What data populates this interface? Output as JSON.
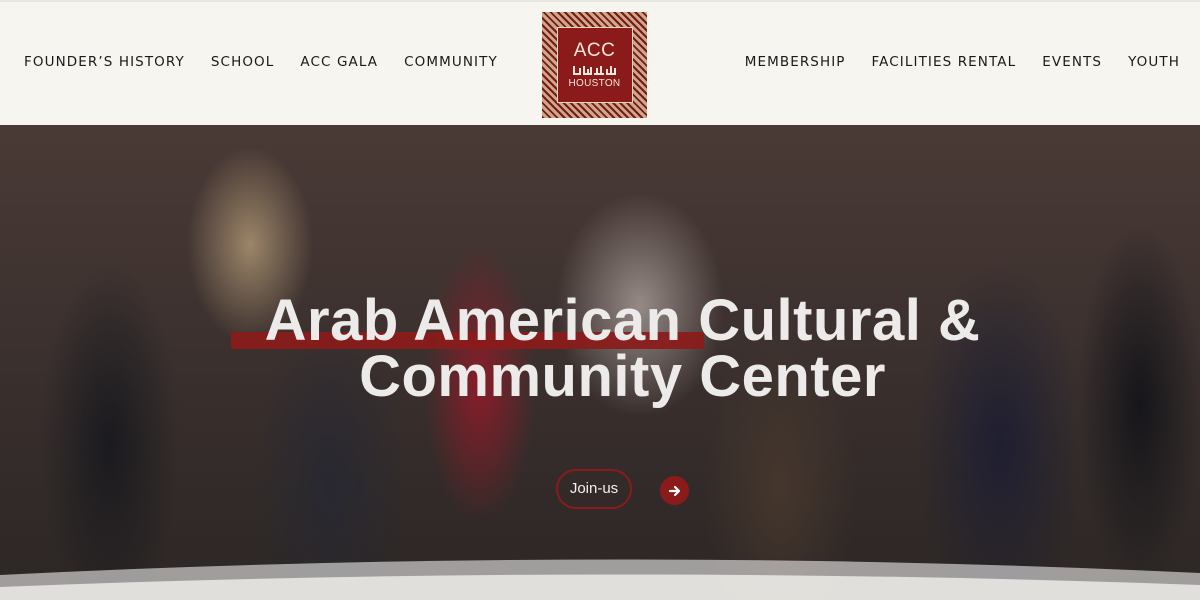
{
  "nav": {
    "left": [
      {
        "label": "FOUNDER’S HISTORY"
      },
      {
        "label": "SCHOOL"
      },
      {
        "label": "ACC GALA"
      },
      {
        "label": "COMMUNITY"
      }
    ],
    "right": [
      {
        "label": "MEMBERSHIP"
      },
      {
        "label": "FACILITIES RENTAL"
      },
      {
        "label": "EVENTS"
      },
      {
        "label": "YOUTH"
      }
    ]
  },
  "logo": {
    "text_top": "ACC",
    "text_bottom": "HOUSTON"
  },
  "hero": {
    "title_line1": "Arab American Cultural &",
    "title_line2": "Community Center",
    "cta_label": "Join-us"
  },
  "colors": {
    "brand": "#8b1b1b",
    "header_bg": "#f7f5f0"
  },
  "icons": {
    "cta_arrow": "arrow-right-circle-icon"
  }
}
